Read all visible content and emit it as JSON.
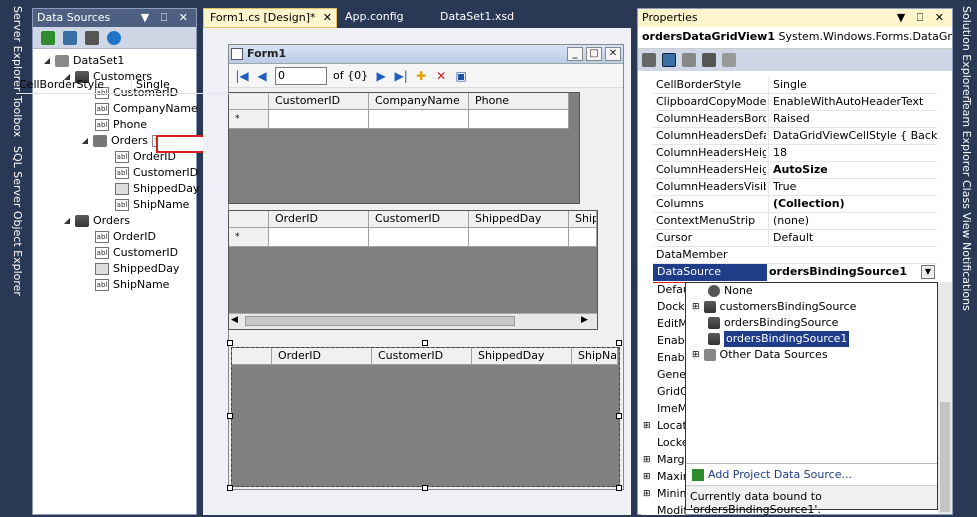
{
  "left_tabs": [
    "Server Explorer",
    "Toolbox",
    "SQL Server Object Explorer"
  ],
  "right_tabs": [
    "Solution Explorer",
    "Team Explorer",
    "Class View",
    "Notifications"
  ],
  "data_sources": {
    "title": "Data Sources",
    "title_buttons": "▼ ⎕ ✕",
    "tree": {
      "dataset": "DataSet1",
      "customers": "Customers",
      "customers_fields": [
        "CustomerID",
        "CompanyName",
        "Phone"
      ],
      "orders_nested": "Orders",
      "orders_nested_fields": [
        "OrderID",
        "CustomerID",
        "ShippedDay",
        "ShipName"
      ],
      "orders": "Orders",
      "orders_fields": [
        "OrderID",
        "CustomerID",
        "ShippedDay",
        "ShipName"
      ],
      "field_icon_text": "abl"
    }
  },
  "tabs": {
    "form_design": "Form1.cs [Design]*",
    "form_close": "✕",
    "app_config": "App.config",
    "dataset_xsd": "DataSet1.xsd"
  },
  "form": {
    "title": "Form1",
    "nav": {
      "position": "0",
      "count": "of {0}"
    },
    "grid1": {
      "columns": [
        "CustomerID",
        "CompanyName",
        "Phone"
      ],
      "row_marker": "*"
    },
    "grid2": {
      "columns": [
        "OrderID",
        "CustomerID",
        "ShippedDay",
        "ShipI"
      ],
      "row_marker": "*"
    },
    "grid3": {
      "columns": [
        "OrderID",
        "CustomerID",
        "ShippedDay",
        "ShipNam"
      ]
    }
  },
  "properties": {
    "title": "Properties",
    "title_buttons": "▼ ⎕ ✕",
    "object": "ordersDataGridView1",
    "object_type": "System.Windows.Forms.DataGridV",
    "rows": [
      {
        "name": "CellBorderStyle",
        "value": "Single"
      },
      {
        "name": "ClipboardCopyMode",
        "value": "EnableWithAutoHeaderText"
      },
      {
        "name": "ColumnHeadersBorder",
        "value": "Raised"
      },
      {
        "name": "ColumnHeadersDefaul",
        "value": "DataGridViewCellStyle { BackColor="
      },
      {
        "name": "ColumnHeadersHeight",
        "value": "18"
      },
      {
        "name": "ColumnHeadersHeight",
        "value": "AutoSize"
      },
      {
        "name": "ColumnHeadersVisible",
        "value": "True"
      },
      {
        "name": "Columns",
        "value": "(Collection)"
      },
      {
        "name": "ContextMenuStrip",
        "value": "(none)"
      },
      {
        "name": "Cursor",
        "value": "Default"
      },
      {
        "name": "DataMember",
        "value": ""
      }
    ],
    "datasource": {
      "name": "DataSource",
      "value": "ordersBindingSource1"
    },
    "below_rows": [
      "Defau",
      "Dock",
      "EditM",
      "Enabl",
      "Enabl",
      "Gener",
      "GridC",
      "ImeM",
      "Locat",
      "Locke",
      "Margi",
      "Maxin",
      "Minim",
      "Modif"
    ],
    "dropdown": {
      "items": [
        "None",
        "customersBindingSource",
        "ordersBindingSource",
        "ordersBindingSource1",
        "Other Data Sources"
      ],
      "add_link": "Add Project Data Source...",
      "status": "Currently data bound to 'ordersBindingSource1'."
    }
  }
}
